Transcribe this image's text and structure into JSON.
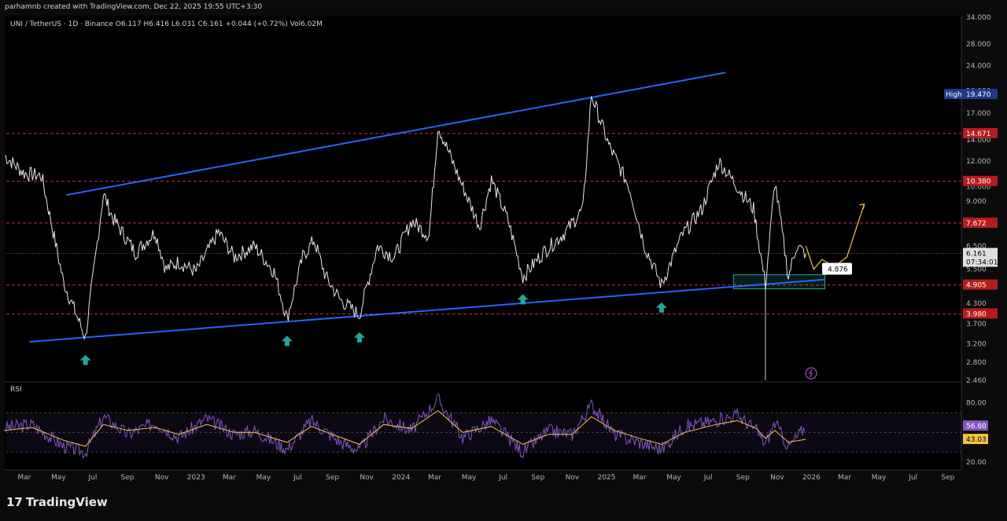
{
  "header": {
    "attribution": "parhamnb created with TradingView.com, Dec 22, 2025 19:55 UTC+3:30",
    "symbol_line": "UNI / TetherUS · 1D · Binance  O6.117  H6.416  L6.031  C6.161  +0.044 (+0.72%)  Vol6.02M"
  },
  "brand": {
    "logo_mark": "17",
    "logo_text": "TradingView"
  },
  "colors": {
    "background": "#000000",
    "price": "#e6e6e6",
    "channel": "#2962ff",
    "level_line": "#d32f2f",
    "arrow": "#26a69a",
    "rsi": "#7e57c2",
    "rsi_ma": "#f5c243",
    "projection": "#f5c243",
    "zone": "#26a69a"
  },
  "chart_data": {
    "type": "line",
    "title": "UNI / TetherUS · 1D · Binance",
    "y_scale": "log",
    "ylim": [
      2.46,
      34.0
    ],
    "y_ticks": [
      "34.000",
      "28.000",
      "24.000",
      "20.000",
      "17.000",
      "14.000",
      "12.000",
      "10.000",
      "9.000",
      "6.500",
      "5.500",
      "4.300",
      "3.700",
      "3.200",
      "2.800",
      "2.460"
    ],
    "x_ticks": [
      "Mar",
      "May",
      "Jul",
      "Sep",
      "Nov",
      "2023",
      "Mar",
      "May",
      "Jul",
      "Sep",
      "Nov",
      "2024",
      "Mar",
      "May",
      "Jul",
      "Sep",
      "Nov",
      "2025",
      "Mar",
      "May",
      "Jul",
      "Sep",
      "Nov",
      "2026",
      "Mar",
      "May",
      "Jul",
      "Sep"
    ],
    "series": [
      {
        "name": "UNI / TetherUS",
        "x": [
          "2022-01-25",
          "2022-03-01",
          "2022-04-01",
          "2022-05-10",
          "2022-06-18",
          "2022-07-20",
          "2022-08-05",
          "2022-09-15",
          "2022-10-20",
          "2022-11-08",
          "2022-12-01",
          "2023-01-01",
          "2023-02-10",
          "2023-03-10",
          "2023-04-15",
          "2023-05-20",
          "2023-06-12",
          "2023-07-10",
          "2023-07-30",
          "2023-08-20",
          "2023-09-15",
          "2023-10-19",
          "2023-11-20",
          "2023-12-20",
          "2024-01-20",
          "2024-02-20",
          "2024-03-07",
          "2024-04-10",
          "2024-05-20",
          "2024-06-10",
          "2024-07-10",
          "2024-08-05",
          "2024-09-10",
          "2024-10-20",
          "2024-11-20",
          "2024-12-05",
          "2025-01-05",
          "2025-02-10",
          "2025-03-10",
          "2025-04-09",
          "2025-05-15",
          "2025-06-20",
          "2025-07-20",
          "2025-08-22",
          "2025-09-20",
          "2025-10-11",
          "2025-10-28",
          "2025-11-21",
          "2025-12-05",
          "2025-12-22"
        ],
        "y": [
          12.5,
          11.0,
          10.8,
          5.0,
          3.35,
          9.5,
          8.0,
          6.2,
          7.2,
          5.5,
          5.8,
          5.4,
          7.2,
          6.0,
          6.5,
          5.4,
          3.85,
          6.0,
          6.8,
          5.2,
          4.4,
          3.95,
          6.5,
          6.0,
          7.8,
          7.0,
          15.5,
          11.0,
          7.5,
          10.5,
          7.8,
          5.2,
          6.2,
          7.2,
          8.5,
          19.47,
          13.5,
          10.0,
          6.5,
          4.9,
          7.0,
          8.5,
          12.0,
          10.0,
          8.5,
          4.9,
          10.38,
          5.2,
          6.5,
          6.161
        ]
      },
      {
        "name": "Channel upper",
        "x": [
          "2022-05-15",
          "2025-08-01"
        ],
        "y": [
          9.4,
          22.8
        ]
      },
      {
        "name": "Channel lower",
        "x": [
          "2022-03-10",
          "2026-01-25"
        ],
        "y": [
          3.25,
          5.1
        ]
      }
    ],
    "horizontal_levels": [
      "14.671",
      "10.380",
      "7.672",
      "4.905",
      "3.980"
    ],
    "price_badges": [
      {
        "label": "High",
        "value": "19.470"
      },
      {
        "label": "",
        "value": "14.671"
      },
      {
        "label": "",
        "value": "10.380"
      },
      {
        "label": "",
        "value": "7.672"
      },
      {
        "label": "",
        "value": "6.161"
      },
      {
        "label": "",
        "value": "07:34:01"
      },
      {
        "label": "",
        "value": "4.905"
      },
      {
        "label": "",
        "value": "3.980"
      }
    ],
    "annotation_callout": "4.876",
    "support_zone": {
      "x": [
        "2025-08-15",
        "2026-01-25"
      ],
      "y": [
        4.77,
        5.28
      ]
    },
    "projection_path": {
      "x": [
        "2025-12-22",
        "2026-01-05",
        "2026-01-20",
        "2026-02-10",
        "2026-03-05",
        "2026-04-05"
      ],
      "y": [
        6.5,
        5.5,
        5.9,
        5.6,
        6.0,
        8.8
      ]
    },
    "support_arrows_dates": [
      "2022-06-18",
      "2023-06-12",
      "2023-10-19",
      "2024-08-05",
      "2025-04-09"
    ],
    "rsi": {
      "title": "RSI",
      "ylim": [
        20,
        90
      ],
      "y_ticks": [
        "80.00",
        "20.00"
      ],
      "levels": [
        70,
        50,
        30
      ],
      "badges": [
        "56.60",
        "43.03"
      ],
      "x": [
        "2022-01-25",
        "2022-03-15",
        "2022-05-10",
        "2022-06-18",
        "2022-07-20",
        "2022-09-01",
        "2022-10-20",
        "2022-12-01",
        "2023-01-20",
        "2023-03-10",
        "2023-04-15",
        "2023-06-12",
        "2023-07-25",
        "2023-09-15",
        "2023-10-19",
        "2023-12-01",
        "2024-01-20",
        "2024-03-07",
        "2024-04-20",
        "2024-06-10",
        "2024-08-05",
        "2024-09-20",
        "2024-11-01",
        "2024-12-05",
        "2025-01-15",
        "2025-03-01",
        "2025-04-09",
        "2025-05-20",
        "2025-07-15",
        "2025-08-22",
        "2025-09-25",
        "2025-10-11",
        "2025-10-28",
        "2025-11-21",
        "2025-12-22"
      ],
      "values": [
        55,
        58,
        36,
        30,
        66,
        48,
        60,
        45,
        64,
        48,
        52,
        33,
        62,
        40,
        32,
        64,
        52,
        84,
        45,
        62,
        30,
        52,
        48,
        78,
        48,
        40,
        33,
        56,
        62,
        68,
        52,
        38,
        60,
        35,
        56.6
      ],
      "ma_values": [
        52,
        55,
        42,
        36,
        58,
        52,
        55,
        48,
        58,
        50,
        50,
        40,
        56,
        45,
        38,
        58,
        54,
        72,
        50,
        56,
        38,
        48,
        48,
        66,
        52,
        44,
        38,
        50,
        58,
        62,
        54,
        44,
        52,
        40,
        43.03
      ]
    }
  }
}
